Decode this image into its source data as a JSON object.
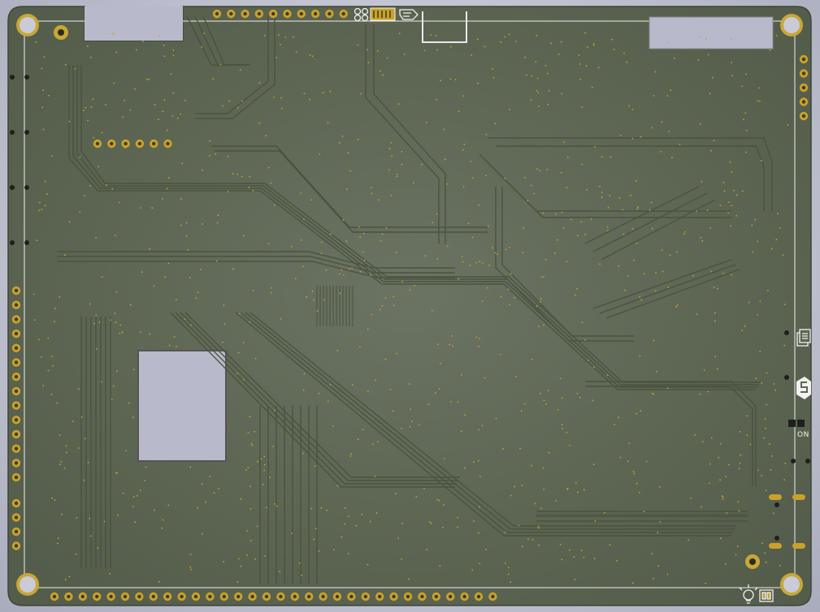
{
  "app": {
    "view": "PCB 3D viewer",
    "side": "bottom"
  },
  "colors": {
    "background": "#c4c6d3",
    "solder_mask": "#5a6551",
    "copper_trace": "#4b5647",
    "pad_gold": "#c9a227",
    "silkscreen": "#f2f2f2",
    "cutout": "#b8bacb"
  },
  "board": {
    "power_indicator_label": "ON",
    "icons": [
      "oshw-icon",
      "ce-icon",
      "recycle-icon",
      "manual-icon",
      "brand-s-icon",
      "lightbulb-icon"
    ],
    "pin_headers": [
      {
        "name": "top-edge-header",
        "pins": 10
      },
      {
        "name": "left-edge-header",
        "pins": 14
      },
      {
        "name": "left-lower-header",
        "pins": 4
      },
      {
        "name": "bottom-edge-header",
        "pins": 32
      },
      {
        "name": "right-top-header",
        "pins": 5
      },
      {
        "name": "inner-header",
        "pins": 6
      }
    ]
  }
}
